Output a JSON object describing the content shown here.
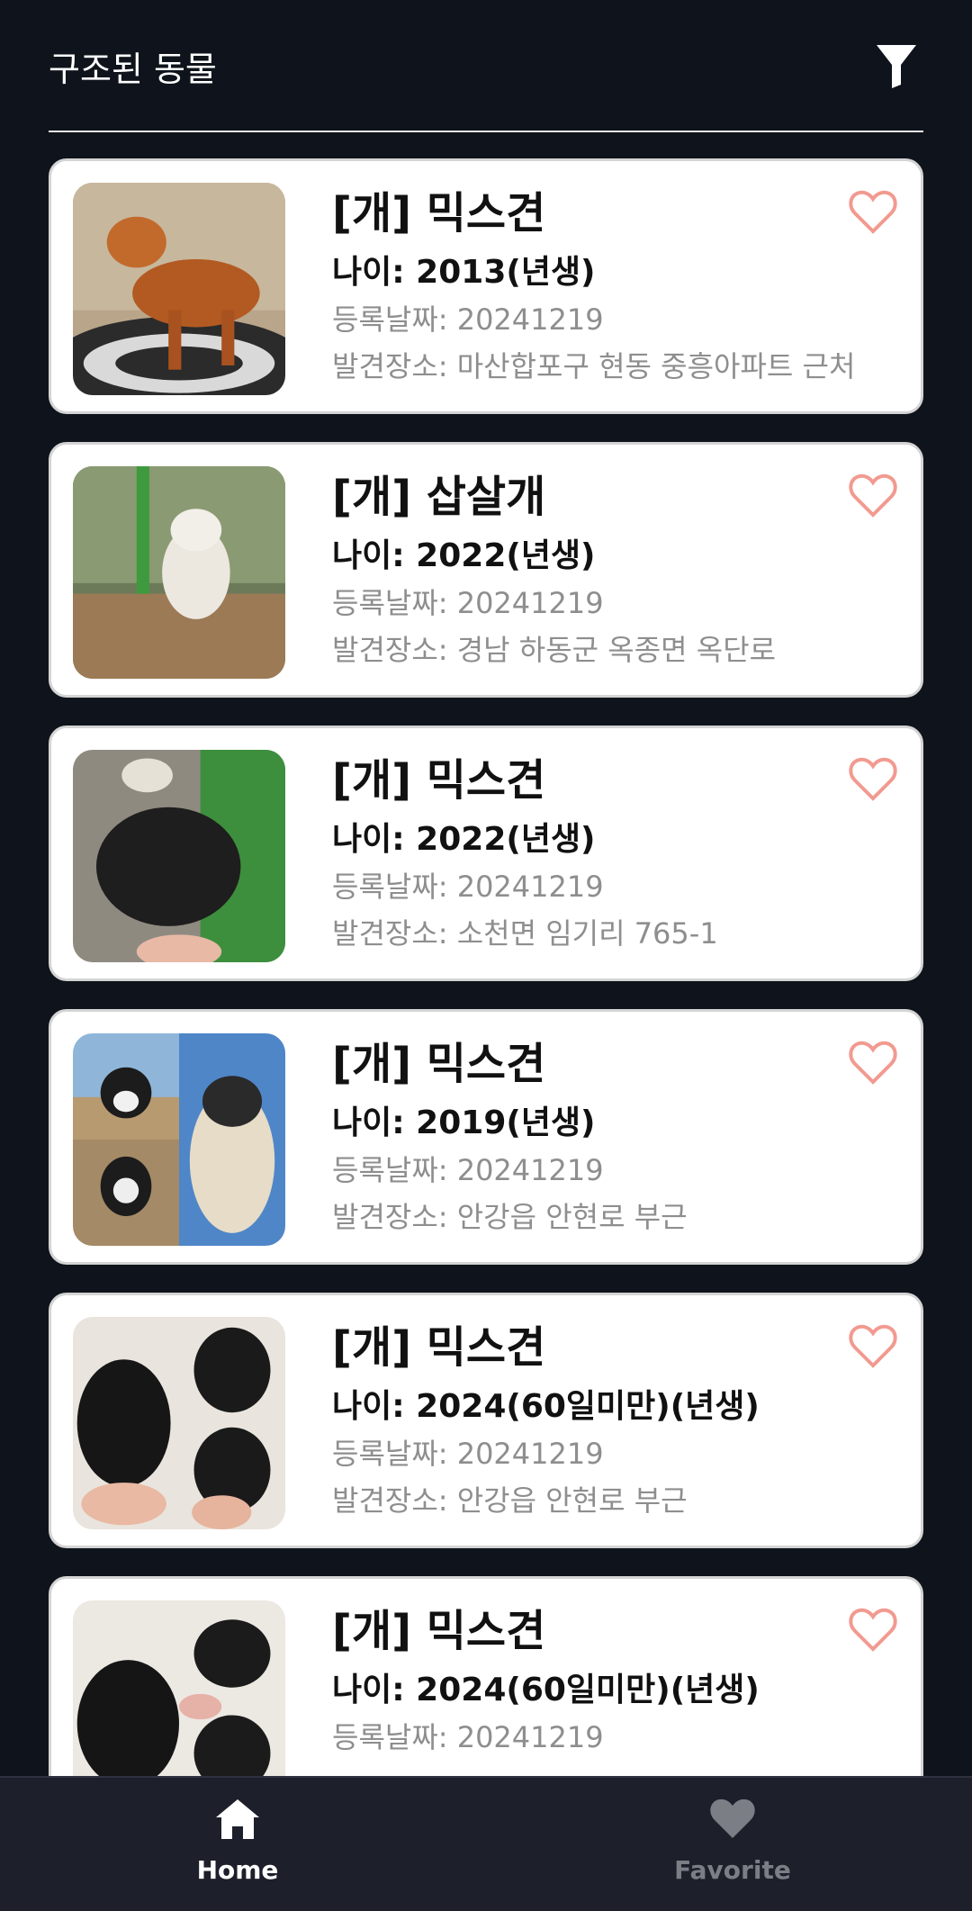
{
  "header": {
    "title": "구조된 동물"
  },
  "animals": [
    {
      "name": "[개] 믹스견",
      "age": "나이: 2013(년생)",
      "date": "등록날짜: 20241219",
      "place": "발견장소: 마산합포구 현동 중흥아파트 근처"
    },
    {
      "name": "[개] 삽살개",
      "age": "나이: 2022(년생)",
      "date": "등록날짜: 20241219",
      "place": "발견장소: 경남 하동군 옥종면 옥단로"
    },
    {
      "name": "[개] 믹스견",
      "age": "나이: 2022(년생)",
      "date": "등록날짜: 20241219",
      "place": "발견장소: 소천면 임기리 765-1"
    },
    {
      "name": "[개] 믹스견",
      "age": "나이: 2019(년생)",
      "date": "등록날짜: 20241219",
      "place": "발견장소: 안강읍 안현로 부근"
    },
    {
      "name": "[개] 믹스견",
      "age": "나이: 2024(60일미만)(년생)",
      "date": "등록날짜: 20241219",
      "place": "발견장소: 안강읍 안현로 부근"
    },
    {
      "name": "[개] 믹스견",
      "age": "나이: 2024(60일미만)(년생)",
      "date": "등록날짜: 20241219",
      "place": ""
    }
  ],
  "nav": {
    "home_label": "Home",
    "favorite_label": "Favorite"
  },
  "colors": {
    "background": "#0f141c",
    "heart": "#f29a90",
    "nav_bg": "#1d202b"
  },
  "icons": {
    "filter": "filter-icon",
    "favorite": "heart-outline-icon",
    "home": "home-icon",
    "favorite_nav": "heart-filled-icon"
  }
}
